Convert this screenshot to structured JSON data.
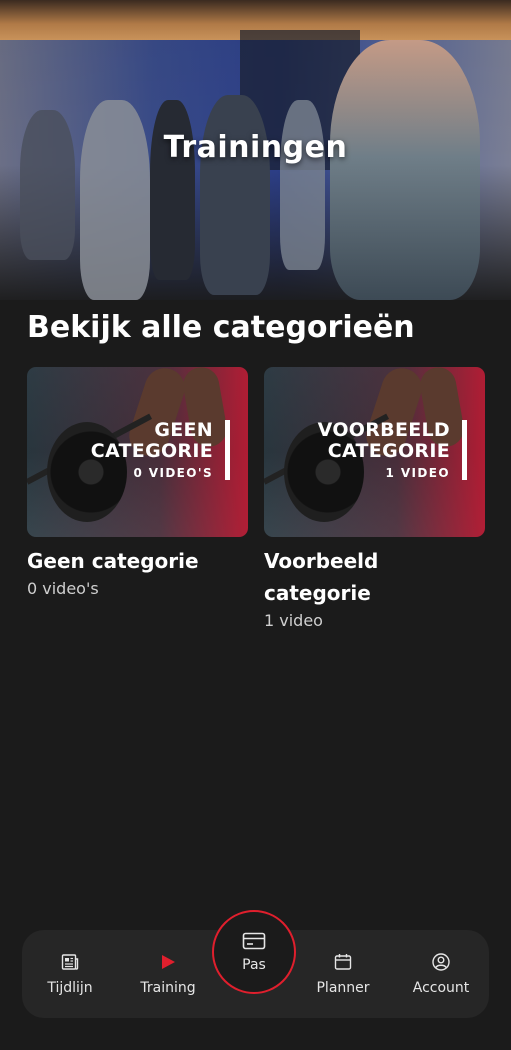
{
  "header": {
    "title": "Trainingen"
  },
  "section": {
    "title": "Bekijk alle categorieën"
  },
  "categories": [
    {
      "overlay_title": "Geen categorie",
      "overlay_count": "0 VIDEO'S",
      "title": "Geen categorie",
      "count": "0 video's"
    },
    {
      "overlay_title": "Voorbeeld categorie",
      "overlay_count": "1 VIDEO",
      "title": "Voorbeeld categorie",
      "count": "1 video"
    }
  ],
  "nav": {
    "tijdlijn": {
      "label": "Tijdlijn",
      "icon": "newspaper-icon"
    },
    "training": {
      "label": "Training",
      "icon": "play-icon"
    },
    "pas": {
      "label": "Pas",
      "icon": "card-icon"
    },
    "planner": {
      "label": "Planner",
      "icon": "calendar-icon"
    },
    "account": {
      "label": "Account",
      "icon": "user-circle-icon"
    }
  },
  "colors": {
    "accent": "#e01f2d",
    "background": "#1b1b1b",
    "nav_bg": "#262626"
  }
}
